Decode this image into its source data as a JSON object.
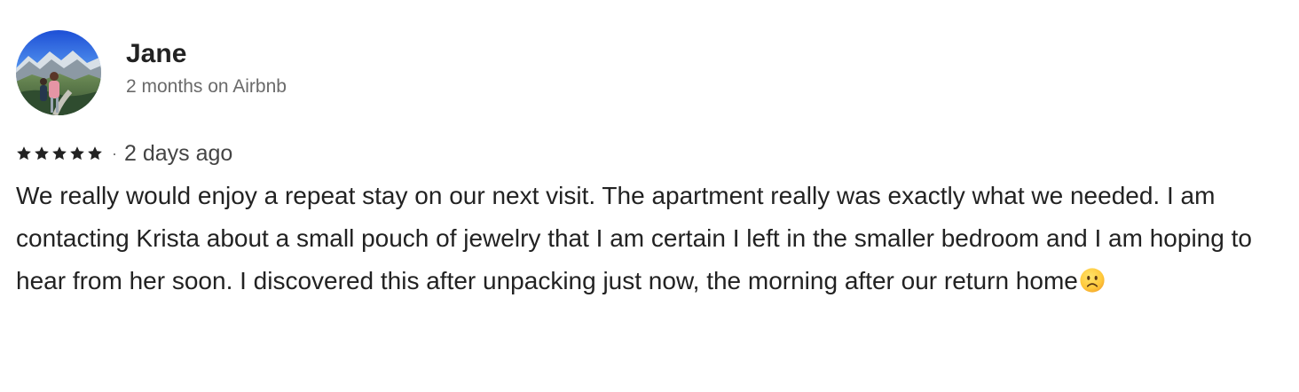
{
  "reviewer": {
    "name": "Jane",
    "tenure": "2 months on Airbnb",
    "avatar_icon": "avatar-photo-icon"
  },
  "review": {
    "rating": 5,
    "separator": "·",
    "date": "2 days ago",
    "text": "We really would enjoy a repeat stay on our next visit.  The apartment really was exactly what we needed.  I am contacting Krista about a small pouch of jewelry that I am certain I left in the smaller bedroom and I am hoping to hear from her soon.  I discovered this after unpacking just now, the morning after our return home",
    "trailing_emoji_icon": "frowning-face-icon"
  },
  "colors": {
    "primary_text": "#222222",
    "secondary_text": "#6a6a6a",
    "star": "#222222"
  }
}
